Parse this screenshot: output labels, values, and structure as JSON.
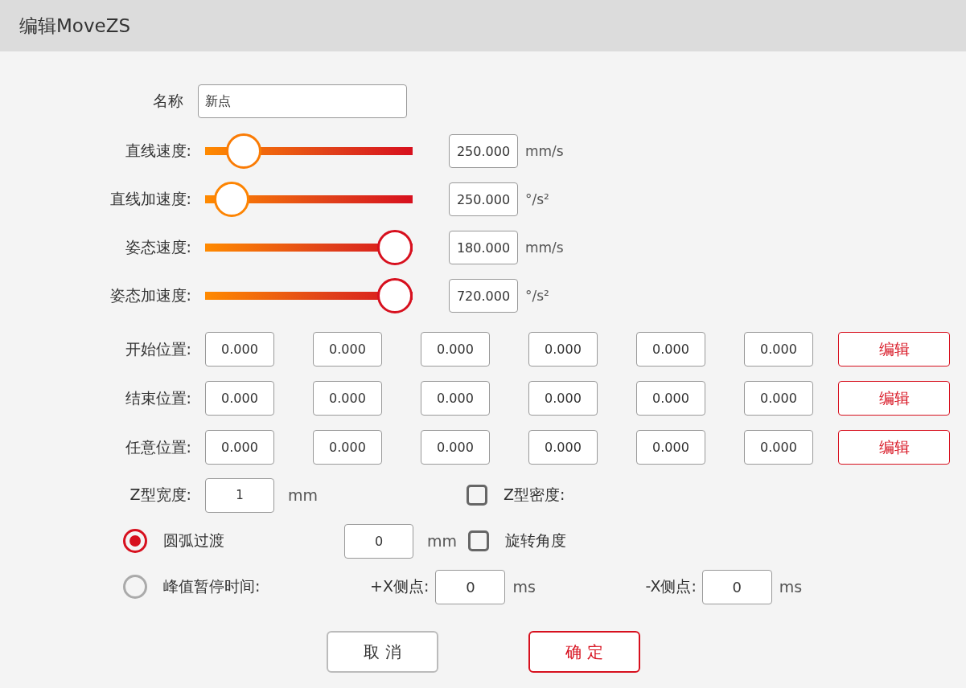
{
  "window": {
    "title": "编辑MoveZS"
  },
  "name_field": {
    "label": "名称",
    "value": "新点"
  },
  "sliders": [
    {
      "label": "直线速度:",
      "level": 0.12,
      "value": "250.000",
      "unit": "mm/s"
    },
    {
      "label": "直线加速度:",
      "level": 0.05,
      "value": "250.000",
      "unit": "°/s²"
    },
    {
      "label": "姿态速度:",
      "level": 1,
      "value": "180.000",
      "unit": "mm/s"
    },
    {
      "label": "姿态加速度:",
      "level": 1,
      "value": "720.000",
      "unit": "°/s²"
    }
  ],
  "positions": [
    {
      "label": "开始位置:",
      "values": [
        "0.000",
        "0.000",
        "0.000",
        "0.000",
        "0.000",
        "0.000"
      ],
      "button": "编辑"
    },
    {
      "label": "结束位置:",
      "values": [
        "0.000",
        "0.000",
        "0.000",
        "0.000",
        "0.000",
        "0.000"
      ],
      "button": "编辑"
    },
    {
      "label": "任意位置:",
      "values": [
        "0.000",
        "0.000",
        "0.000",
        "0.000",
        "0.000",
        "0.000"
      ],
      "button": "编辑"
    }
  ],
  "z_width": {
    "label": "Z型宽度:",
    "value": "1",
    "unit": "mm"
  },
  "z_density": {
    "label": "Z型密度:",
    "checked": false
  },
  "modes": [
    {
      "label": "圆弧过渡",
      "selected": true,
      "value": "0",
      "unit": "mm"
    },
    {
      "label": "峰值暂停时间:",
      "selected": false
    }
  ],
  "rotation": {
    "label": "旋转角度",
    "checked": false
  },
  "plus_x": {
    "label": "+X侧点:",
    "value": "0",
    "unit": "ms"
  },
  "minus_x": {
    "label": "-X侧点:",
    "value": "0",
    "unit": "ms"
  },
  "buttons": [
    {
      "label": "取 消",
      "kind": "cancel"
    },
    {
      "label": "确 定",
      "kind": "confirm"
    }
  ]
}
